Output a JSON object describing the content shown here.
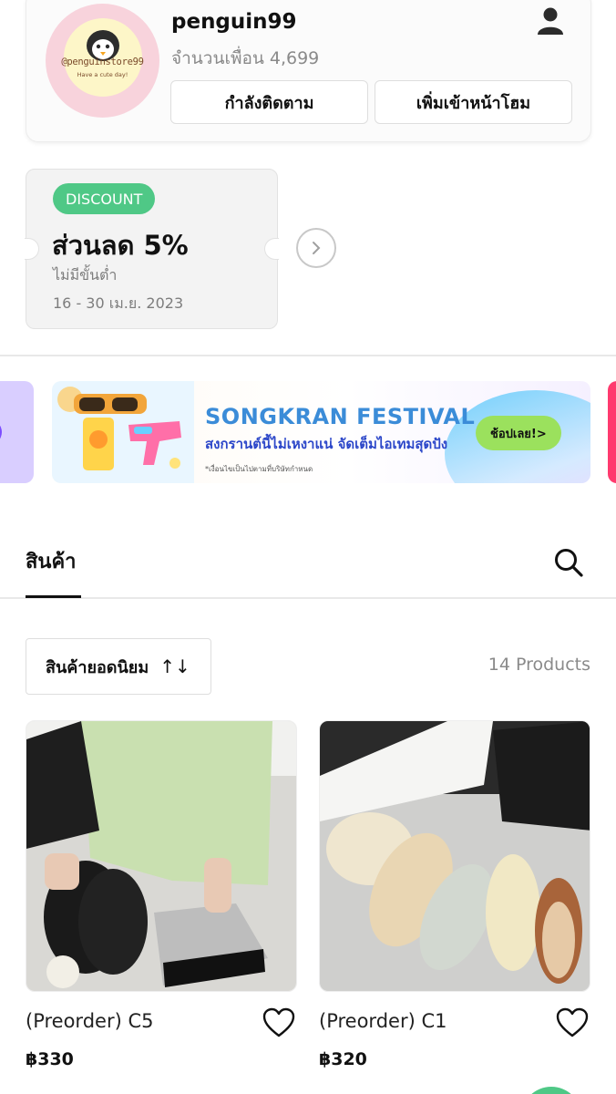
{
  "profile": {
    "username": "penguin99",
    "friends_label": "จำนวนเพื่อน",
    "friends_count": "4,699",
    "avatar_handle": "@penguinstore99",
    "avatar_tagline": "Have a cute day!",
    "follow_label": "กำลังติดตาม",
    "add_home_label": "เพิ่มเข้าหน้าโฮม",
    "user_icon": "user-icon"
  },
  "coupon": {
    "badge": "DISCOUNT",
    "title": "ส่วนลด 5%",
    "condition": "ไม่มีขั้นต่ำ",
    "date_range": "16 - 30 เม.ย. 2023",
    "next_icon": "chevron-right-icon"
  },
  "banner": {
    "title": "SONGKRAN FESTIVAL",
    "subtitle": "สงกรานต์นี้ไม่เหงาแน่ จัดเต็มไอเทมสุดปัง",
    "note": "*เงื่อนไขเป็นไปตามที่บริษัทกำหนด",
    "cta": "ช้อปเลย!>"
  },
  "tabs": {
    "products_label": "สินค้า",
    "search_icon": "search-icon"
  },
  "sort": {
    "label": "สินค้ายอดนิยม",
    "icon": "↑↓"
  },
  "product_count": "14 Products",
  "products": [
    {
      "name": "(Preorder) C5",
      "price": "฿330"
    },
    {
      "name": "(Preorder) C1",
      "price": "฿320"
    }
  ],
  "colors": {
    "accent_green": "#4fc886",
    "banner_blue": "#3b8cd8"
  }
}
